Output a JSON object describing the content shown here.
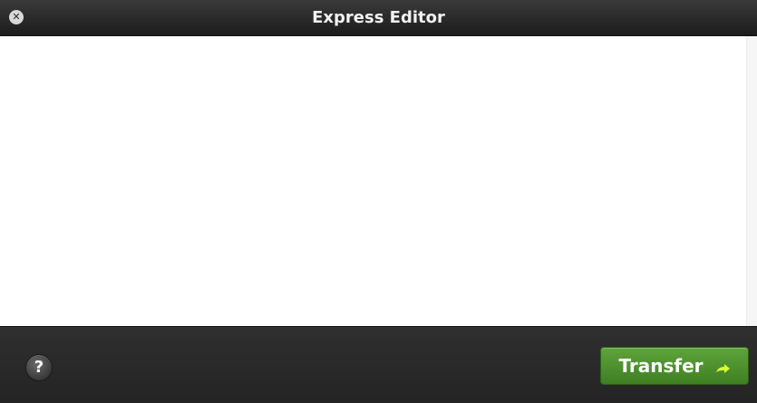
{
  "window": {
    "title": "Express Editor",
    "close_icon_glyph": "✕"
  },
  "footer": {
    "help_label": "?",
    "transfer_label": "Transfer"
  },
  "icons": {
    "close": "close-icon",
    "help": "help-icon",
    "transfer_arrow": "arrow-right-icon"
  },
  "colors": {
    "titlebar": "#1f1f1f",
    "content": "#ffffff",
    "footer": "#2a2a2a",
    "accent_green": "#4a8f2c",
    "arrow_yellow": "#d7ff3a"
  }
}
